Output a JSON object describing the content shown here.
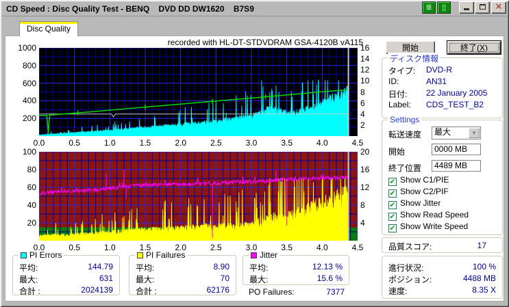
{
  "window": {
    "title": "CD Speed : Disc Quality Test - BENQ    DVD DD DW1620    B7S9"
  },
  "tab": {
    "label": "Disc Quality"
  },
  "chart_header": "recorded with HL-DT-STDVDRAM GSA-4120B vA115",
  "actions": {
    "start": "開始",
    "exit_pre": "終了(",
    "exit_key": "X",
    "exit_post": ")"
  },
  "disc_info": {
    "title": "ディスク情報",
    "rows": [
      {
        "label": "タイプ:",
        "value": "DVD-R"
      },
      {
        "label": "ID:",
        "value": "AN31"
      },
      {
        "label": "日付:",
        "value": "22 January 2005"
      },
      {
        "label": "Label:",
        "value": "CDS_TEST_B2"
      }
    ]
  },
  "settings": {
    "title": "Settings",
    "transfer_rate": {
      "label": "転送速度",
      "value": "最大"
    },
    "start": {
      "label": "開始",
      "value": "0000 MB"
    },
    "end": {
      "label": "終了位置",
      "value": "4489 MB"
    },
    "checkboxes": [
      {
        "label": "Show C1/PIE",
        "checked": true
      },
      {
        "label": "Show C2/PIF",
        "checked": true
      },
      {
        "label": "Show Jitter",
        "checked": true
      },
      {
        "label": "Show Read Speed",
        "checked": true
      },
      {
        "label": "Show Write Speed",
        "checked": true
      }
    ]
  },
  "quality_score": {
    "label": "品質スコア:",
    "value": "17"
  },
  "progress": {
    "rows": [
      {
        "label": "進行状況:",
        "value": "100 %"
      },
      {
        "label": "ポジション:",
        "value": "4488 MB"
      },
      {
        "label": "速度:",
        "value": "8.35 X"
      }
    ]
  },
  "stats": {
    "pi_errors": {
      "title": "PI Errors",
      "chip_color": "#00FFFF",
      "rows": [
        {
          "label": "平均:",
          "value": "144.79"
        },
        {
          "label": "最大:",
          "value": "631"
        },
        {
          "label": "合計 :",
          "value": "2024139"
        }
      ]
    },
    "pi_failures": {
      "title": "PI Failures",
      "chip_color": "#FFFF00",
      "rows": [
        {
          "label": "平均:",
          "value": "8.90"
        },
        {
          "label": "最大:",
          "value": "70"
        },
        {
          "label": "合計 :",
          "value": "62176"
        }
      ]
    },
    "jitter": {
      "title": "Jitter",
      "chip_color": "#FF00FF",
      "rows": [
        {
          "label": "平均:",
          "value": "12.13 %"
        },
        {
          "label": "最大:",
          "value": "15.6 %"
        }
      ]
    },
    "po_failures": {
      "label": "PO Failures:",
      "value": "7377"
    }
  },
  "chart_data": [
    {
      "name": "pi-errors-and-speed-chart",
      "type": "area",
      "bg": "#000000",
      "grid": {
        "minor_color": "#0000A0",
        "major_color": "#2A2AE8"
      },
      "x": {
        "min": 0,
        "max": 4.5,
        "minor": 0.1,
        "major": 0.5,
        "ticks": [
          [
            0,
            "0.0"
          ],
          [
            0.5,
            "0.5"
          ],
          [
            1,
            "1.0"
          ],
          [
            1.5,
            "1.5"
          ],
          [
            2,
            "2.0"
          ],
          [
            2.5,
            "2.5"
          ],
          [
            3,
            "3.0"
          ],
          [
            3.5,
            "3.5"
          ],
          [
            4,
            "4.0"
          ],
          [
            4.5,
            "4.5"
          ]
        ]
      },
      "left": {
        "min": 0,
        "max": 1000,
        "minor": 100,
        "major": 200,
        "ticks": [
          [
            1000,
            "1000"
          ],
          [
            800,
            "800"
          ],
          [
            600,
            "600"
          ],
          [
            400,
            "400"
          ],
          [
            200,
            "200"
          ]
        ]
      },
      "right": {
        "min": 0,
        "max": 16,
        "ticks": [
          [
            16,
            "16"
          ],
          [
            14,
            "14"
          ],
          [
            12,
            "12"
          ],
          [
            10,
            "10"
          ],
          [
            8,
            "8"
          ],
          [
            6,
            "6"
          ],
          [
            4,
            "4"
          ],
          [
            2,
            "2"
          ]
        ]
      },
      "end_marker": {
        "x": 4.37,
        "color": "#C8C8C8"
      },
      "series": [
        {
          "name": "pi-errors-area",
          "legend": "PI Errors",
          "type": "area",
          "axis": "left",
          "color": "#00FFFF",
          "seed": 11,
          "noise": 0.5,
          "clamp_max": 635,
          "points": [
            [
              0,
              12
            ],
            [
              0.2,
              22
            ],
            [
              0.4,
              32
            ],
            [
              0.6,
              42
            ],
            [
              0.8,
              52
            ],
            [
              1,
              62
            ],
            [
              1.2,
              75
            ],
            [
              1.4,
              88
            ],
            [
              1.6,
              100
            ],
            [
              1.8,
              112
            ],
            [
              2,
              125
            ],
            [
              2.2,
              140
            ],
            [
              2.4,
              155
            ],
            [
              2.6,
              172
            ],
            [
              2.8,
              190
            ],
            [
              3,
              215
            ],
            [
              3.1,
              255
            ],
            [
              3.2,
              285
            ],
            [
              3.3,
              295
            ],
            [
              3.4,
              275
            ],
            [
              3.5,
              258
            ],
            [
              3.6,
              255
            ],
            [
              3.7,
              268
            ],
            [
              3.8,
              295
            ],
            [
              3.9,
              325
            ],
            [
              4,
              355
            ],
            [
              4.1,
              395
            ],
            [
              4.2,
              435
            ],
            [
              4.3,
              465
            ],
            [
              4.35,
              485
            ],
            [
              4.37,
              495
            ]
          ]
        },
        {
          "name": "write-speed-line",
          "legend": "Write Speed",
          "type": "line",
          "axis": "right",
          "color": "#C8C8C8",
          "width": 1,
          "points": [
            [
              0,
              4
            ],
            [
              1.02,
              4
            ],
            [
              1.05,
              3.5
            ],
            [
              1.08,
              4
            ],
            [
              4.37,
              4
            ]
          ]
        },
        {
          "name": "read-speed-line",
          "legend": "Read Speed",
          "type": "line",
          "axis": "right",
          "color": "#00D800",
          "width": 1.5,
          "tick_marks": [
            0.55,
            1.5,
            2.45,
            3.2
          ],
          "points": [
            [
              0,
              3.7
            ],
            [
              0.11,
              3.77
            ],
            [
              0.13,
              0.55
            ],
            [
              0.15,
              3.8
            ],
            [
              0.5,
              4.15
            ],
            [
              1,
              4.7
            ],
            [
              1.5,
              5.25
            ],
            [
              2,
              5.8
            ],
            [
              2.5,
              6.35
            ],
            [
              3,
              6.9
            ],
            [
              3.5,
              7.45
            ],
            [
              4,
              8.05
            ],
            [
              4.37,
              8.4
            ]
          ]
        }
      ]
    },
    {
      "name": "pi-failures-and-jitter-chart",
      "type": "area",
      "bg": "#8B1414",
      "grid": {
        "minor_color": "#0000A0",
        "major_color": "#2A2AE8"
      },
      "zones": [
        {
          "from": 0,
          "to": 15,
          "axis": "left",
          "color": "#0C7C0C"
        }
      ],
      "x": {
        "min": 0,
        "max": 4.5,
        "minor": 0.1,
        "major": 0.5,
        "ticks": [
          [
            0,
            "0.0"
          ],
          [
            0.5,
            "0.5"
          ],
          [
            1,
            "1.0"
          ],
          [
            1.5,
            "1.5"
          ],
          [
            2,
            "2.0"
          ],
          [
            2.5,
            "2.5"
          ],
          [
            3,
            "3.0"
          ],
          [
            3.5,
            "3.5"
          ],
          [
            4,
            "4.0"
          ],
          [
            4.5,
            "4.5"
          ]
        ]
      },
      "left": {
        "min": 0,
        "max": 100,
        "minor": 10,
        "major": 20,
        "ticks": [
          [
            100,
            "100"
          ],
          [
            80,
            "80"
          ],
          [
            60,
            "60"
          ],
          [
            40,
            "40"
          ],
          [
            20,
            "20"
          ]
        ]
      },
      "right": {
        "min": 0,
        "max": 20,
        "ticks": [
          [
            20,
            "20"
          ],
          [
            16,
            "16"
          ],
          [
            12,
            "12"
          ],
          [
            8,
            "8"
          ],
          [
            4,
            "4"
          ]
        ]
      },
      "end_marker": {
        "x": 4.37,
        "color": "#C8C8C8"
      },
      "series": [
        {
          "name": "pi-failures-area",
          "legend": "PI Failures",
          "type": "area",
          "axis": "left",
          "color": "#FFFF00",
          "seed": 23,
          "noise": 0.85,
          "clamp_max": 70,
          "points": [
            [
              0,
              5
            ],
            [
              0.2,
              6
            ],
            [
              0.4,
              6
            ],
            [
              0.6,
              7
            ],
            [
              0.8,
              8
            ],
            [
              1,
              9
            ],
            [
              1.2,
              10
            ],
            [
              1.4,
              11
            ],
            [
              1.6,
              12
            ],
            [
              1.8,
              13
            ],
            [
              2,
              13
            ],
            [
              2.2,
              14
            ],
            [
              2.4,
              15
            ],
            [
              2.6,
              15
            ],
            [
              2.8,
              16
            ],
            [
              3,
              17
            ],
            [
              3.1,
              20
            ],
            [
              3.2,
              23
            ],
            [
              3.3,
              25
            ],
            [
              3.4,
              24
            ],
            [
              3.5,
              25
            ],
            [
              3.6,
              27
            ],
            [
              3.7,
              30
            ],
            [
              3.8,
              33
            ],
            [
              3.9,
              36
            ],
            [
              4,
              38
            ],
            [
              4.1,
              42
            ],
            [
              4.2,
              45
            ],
            [
              4.3,
              48
            ],
            [
              4.37,
              46
            ]
          ]
        },
        {
          "name": "jitter-line",
          "legend": "Jitter",
          "type": "line",
          "axis": "left",
          "color": "#FF00FF",
          "width": 1,
          "seed": 37,
          "noise_abs": 2.2,
          "spikes": [
            [
              0.95,
              75
            ],
            [
              1.2,
              80
            ],
            [
              1.23,
              48
            ],
            [
              2.45,
              3
            ],
            [
              3.35,
              79
            ],
            [
              3.5,
              17
            ]
          ],
          "points": [
            [
              0,
              53
            ],
            [
              0.2,
              55
            ],
            [
              0.4,
              56
            ],
            [
              0.6,
              56
            ],
            [
              0.8,
              57
            ],
            [
              1,
              59
            ],
            [
              1.2,
              61
            ],
            [
              1.4,
              62
            ],
            [
              1.6,
              63
            ],
            [
              1.8,
              63
            ],
            [
              2,
              63
            ],
            [
              2.2,
              64
            ],
            [
              2.4,
              64
            ],
            [
              2.6,
              65
            ],
            [
              2.8,
              66
            ],
            [
              3,
              66
            ],
            [
              3.2,
              67
            ],
            [
              3.4,
              69
            ],
            [
              3.6,
              69
            ],
            [
              3.8,
              70
            ],
            [
              4,
              70
            ],
            [
              4.2,
              71
            ],
            [
              4.37,
              71
            ]
          ]
        }
      ]
    }
  ]
}
